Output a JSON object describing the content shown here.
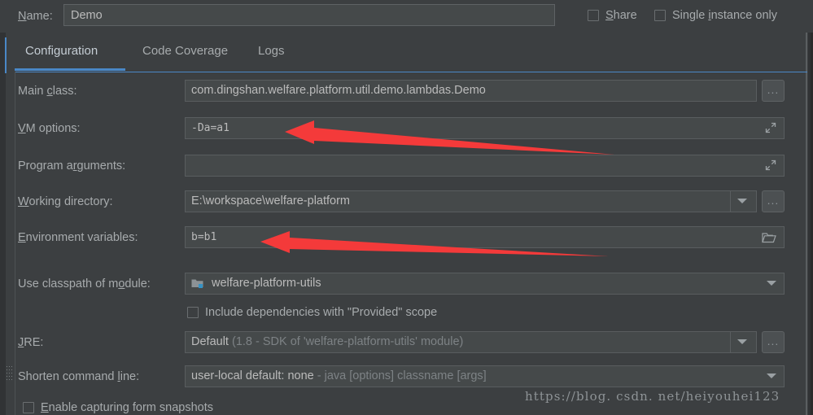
{
  "window": {
    "title": "Run/Debug Configurations - Configuration tab",
    "background_color": "#3c3f41",
    "accent_color": "#4a88c7",
    "annotation_color": "#f43a3a"
  },
  "name_row": {
    "label": "Name:",
    "label_mnemonic": "N",
    "value": "Demo",
    "placeholder": "Name",
    "share_checkbox": {
      "label": "Share",
      "mnemonic": "S",
      "checked": false
    },
    "single_instance_checkbox": {
      "label": "Single instance only",
      "mnemonic": "i",
      "checked": false
    }
  },
  "tabs": [
    {
      "label": "Configuration",
      "active": true
    },
    {
      "label": "Code Coverage",
      "active": false
    },
    {
      "label": "Logs",
      "active": false
    }
  ],
  "fields": {
    "main_class": {
      "label": "Main class:",
      "value": "com.dingshan.welfare.platform.util.demo.lambdas.Demo",
      "browse_button": "...",
      "browse_icon": "ellipsis-icon"
    },
    "vm_options": {
      "label": "VM options:",
      "value": "-Da=a1",
      "expand_icon": "expand-diagonal-icon"
    },
    "program_arguments": {
      "label": "Program arguments:",
      "value": "",
      "expand_icon": "expand-diagonal-icon"
    },
    "working_directory": {
      "label": "Working directory:",
      "value": "E:\\workspace\\welfare-platform",
      "dropdown_icon": "chevron-down-icon",
      "browse_button": "...",
      "browse_icon": "ellipsis-icon"
    },
    "environment_variables": {
      "label": "Environment variables:",
      "value": "b=b1",
      "browse_icon": "folder-icon"
    },
    "use_classpath_of_module": {
      "label": "Use classpath of module:",
      "value": "welfare-platform-utils",
      "item_icon": "module-icon",
      "dropdown_icon": "chevron-down-icon"
    },
    "include_provided_scope": {
      "label": "Include dependencies with \"Provided\" scope",
      "checked": false
    },
    "jre": {
      "label": "JRE:",
      "value_main": "Default",
      "value_detail": "(1.8 - SDK of 'welfare-platform-utils' module)",
      "dropdown_icon": "chevron-down-icon",
      "browse_button": "...",
      "browse_icon": "ellipsis-icon"
    },
    "shorten_command_line": {
      "label": "Shorten command line:",
      "value_main": "user-local default: none",
      "value_detail": "- java [options] classname [args]",
      "dropdown_icon": "chevron-down-icon"
    },
    "enable_form_snapshots": {
      "label": "Enable capturing form snapshots",
      "mnemonic": "E",
      "checked": false
    }
  },
  "annotations": [
    {
      "name": "arrow-to-vm-options",
      "points_at": "vm_options"
    },
    {
      "name": "arrow-to-environment-variables",
      "points_at": "environment_variables"
    }
  ],
  "watermark": {
    "text": "https://blog. csdn. net/heiyouhei123"
  }
}
